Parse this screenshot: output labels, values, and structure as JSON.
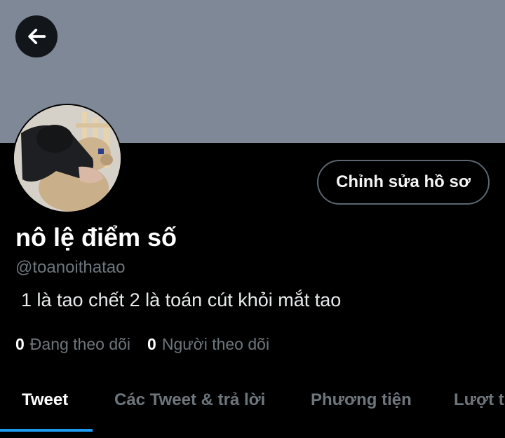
{
  "header": {
    "back_icon": "arrow-left-icon"
  },
  "profile": {
    "display_name": "nô lệ điểm số",
    "handle": "@toanoithatao",
    "bio": "1 là tao chết 2 là toán cút khỏi mắt tao",
    "edit_button_label": "Chỉnh sửa hồ sơ",
    "following_count": "0",
    "following_label": "Đang theo dõi",
    "followers_count": "0",
    "followers_label": "Người theo dõi"
  },
  "tabs": [
    {
      "label": "Tweet",
      "active": true
    },
    {
      "label": "Các Tweet & trả lời",
      "active": false
    },
    {
      "label": "Phương tiện",
      "active": false
    },
    {
      "label": "Lượt thích",
      "active": false
    }
  ],
  "colors": {
    "banner": "#7e8896",
    "background": "#000000",
    "accent": "#1d9bf0",
    "muted_text": "#6e767d"
  }
}
